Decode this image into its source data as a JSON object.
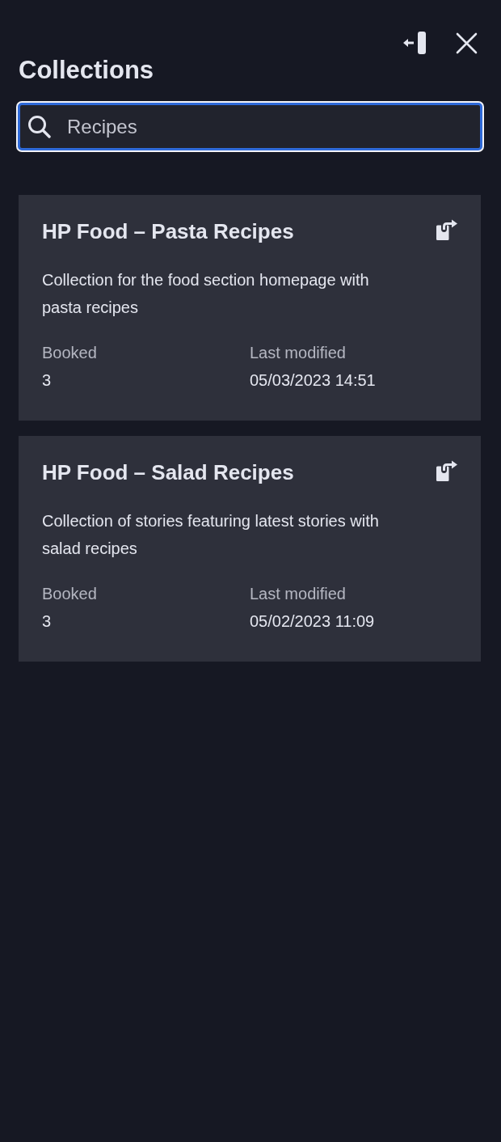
{
  "header": {
    "title": "Collections"
  },
  "search": {
    "value": "Recipes",
    "focused": true
  },
  "collections": [
    {
      "title": "HP Food – Pasta Recipes",
      "description": "Collection for the food section homepage with pasta recipes",
      "fields": [
        {
          "label": "Booked",
          "value": "3"
        },
        {
          "label": "Last modified",
          "value": "05/03/2023 14:51"
        }
      ]
    },
    {
      "title": "HP Food – Salad Recipes",
      "description": "Collection of stories featuring latest stories with salad recipes",
      "fields": [
        {
          "label": "Booked",
          "value": "3"
        },
        {
          "label": "Last modified",
          "value": "05/02/2023 11:09"
        }
      ]
    }
  ]
}
